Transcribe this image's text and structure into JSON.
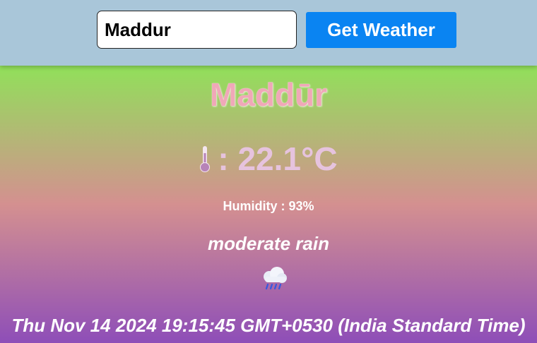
{
  "search": {
    "value": "Maddur",
    "button_label": "Get Weather"
  },
  "weather": {
    "city": "Maddūr",
    "temperature_text": ": 22.1°C",
    "humidity_text": "Humidity : 93%",
    "description": "moderate rain",
    "icon": "rain-cloud-icon",
    "datetime": "Thu Nov 14 2024 19:15:45 GMT+0530 (India Standard Time)"
  },
  "colors": {
    "topbar": "#a9c6d9",
    "button": "#0a84f2",
    "gradient_top": "#91e05a",
    "gradient_mid": "#d49090",
    "gradient_bottom": "#8e4eb8"
  }
}
